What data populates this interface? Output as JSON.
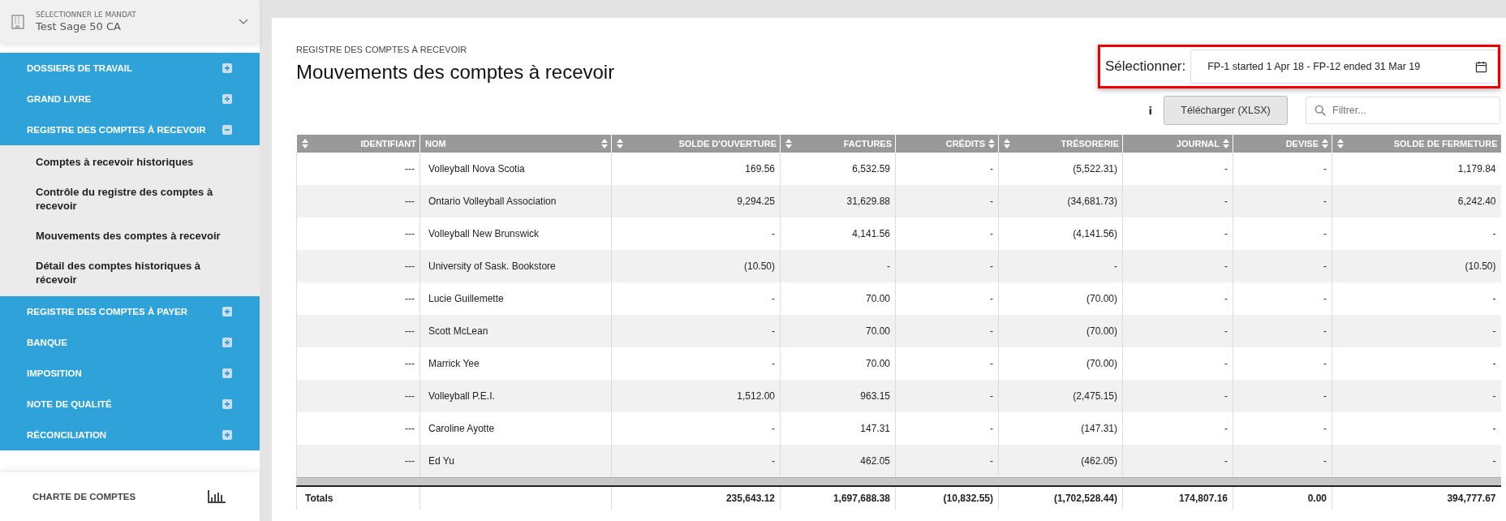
{
  "mandate": {
    "label": "SÉLECTIONNER LE MANDAT",
    "value": "Test Sage 50 CA"
  },
  "nav": [
    {
      "label": "DOSSIERS DE TRAVAIL",
      "expanded": false
    },
    {
      "label": "GRAND LIVRE",
      "expanded": false
    },
    {
      "label": "REGISTRE DES COMPTES À RECEVOIR",
      "expanded": true,
      "children": [
        {
          "label": "Comptes à recevoir historiques"
        },
        {
          "label": "Contrôle du registre des comptes à recevoir"
        },
        {
          "label": "Mouvements des comptes à recevoir"
        },
        {
          "label": "Détail des comptes historiques à récevoir"
        }
      ]
    },
    {
      "label": "REGISTRE DES COMPTES À PAYER",
      "expanded": false
    },
    {
      "label": "BANQUE",
      "expanded": false
    },
    {
      "label": "IMPOSITION",
      "expanded": false
    },
    {
      "label": "NOTE DE QUALITÉ",
      "expanded": false
    },
    {
      "label": "RÉCONCILIATION",
      "expanded": false
    }
  ],
  "chart_of_accounts": {
    "label": "CHARTE DE COMPTES"
  },
  "breadcrumb": "REGISTRE DES COMPTES À RECEVOIR",
  "title": "Mouvements des comptes à recevoir",
  "period": {
    "label": "Sélectionner:",
    "value": "FP-1 started 1 Apr 18 - FP-12 ended 31 Mar 19"
  },
  "toolbar": {
    "info": "i",
    "download": "Télécharger (XLSX)",
    "filter_placeholder": "Filtrer..."
  },
  "table": {
    "columns": [
      {
        "label": "IDENTIFIANT",
        "kind": "leading"
      },
      {
        "label": "NOM",
        "kind": "trailing"
      },
      {
        "label": "SOLDE D'OUVERTURE",
        "kind": "leading"
      },
      {
        "label": "FACTURES",
        "kind": "leading"
      },
      {
        "label": "CRÉDITS",
        "kind": "trailing"
      },
      {
        "label": "TRÉSORERIE",
        "kind": "leading"
      },
      {
        "label": "JOURNAL",
        "kind": "trailing"
      },
      {
        "label": "DEVISE",
        "kind": "trailing"
      },
      {
        "label": "SOLDE DE FERMETURE",
        "kind": "leading"
      }
    ],
    "rows": [
      [
        "---",
        "Volleyball Nova Scotia",
        "169.56",
        "6,532.59",
        "-",
        "(5,522.31)",
        "-",
        "-",
        "1,179.84"
      ],
      [
        "---",
        "Ontario Volleyball Association",
        "9,294.25",
        "31,629.88",
        "-",
        "(34,681.73)",
        "-",
        "-",
        "6,242.40"
      ],
      [
        "---",
        "Volleyball New Brunswick",
        "-",
        "4,141.56",
        "-",
        "(4,141.56)",
        "-",
        "-",
        "-"
      ],
      [
        "---",
        "University of Sask. Bookstore",
        "(10.50)",
        "-",
        "-",
        "-",
        "-",
        "-",
        "(10.50)"
      ],
      [
        "---",
        "Lucie Guillemette",
        "-",
        "70.00",
        "-",
        "(70.00)",
        "-",
        "-",
        "-"
      ],
      [
        "---",
        "Scott McLean",
        "-",
        "70.00",
        "-",
        "(70.00)",
        "-",
        "-",
        "-"
      ],
      [
        "---",
        "Marrick Yee",
        "-",
        "70.00",
        "-",
        "(70.00)",
        "-",
        "-",
        "-"
      ],
      [
        "---",
        "Volleyball P.E.I.",
        "1,512.00",
        "963.15",
        "-",
        "(2,475.15)",
        "-",
        "-",
        "-"
      ],
      [
        "---",
        "Caroline Ayotte",
        "-",
        "147.31",
        "-",
        "(147.31)",
        "-",
        "-",
        "-"
      ],
      [
        "---",
        "Ed Yu",
        "-",
        "462.05",
        "-",
        "(462.05)",
        "-",
        "-",
        "-"
      ]
    ],
    "totals": {
      "label": "Totals",
      "values": [
        "235,643.12",
        "1,697,688.38",
        "(10,832.55)",
        "(1,702,528.44)",
        "174,807.16",
        "0.00",
        "394,777.67"
      ]
    }
  }
}
